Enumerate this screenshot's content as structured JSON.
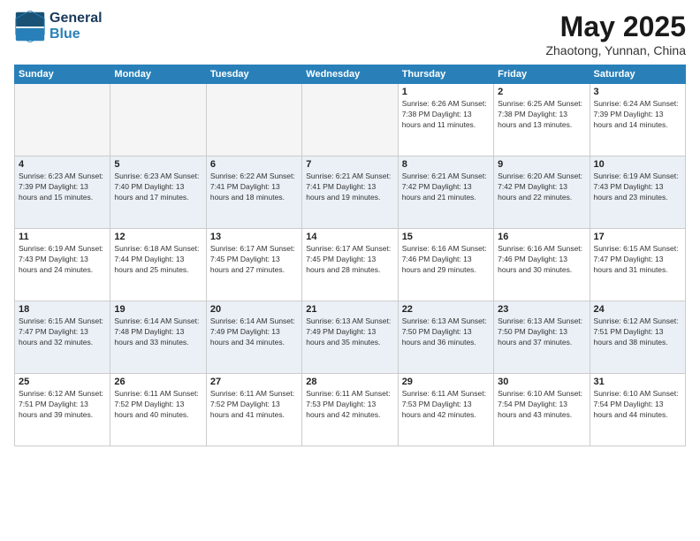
{
  "header": {
    "logo_line1": "General",
    "logo_line2": "Blue",
    "month": "May 2025",
    "location": "Zhaotong, Yunnan, China"
  },
  "days_of_week": [
    "Sunday",
    "Monday",
    "Tuesday",
    "Wednesday",
    "Thursday",
    "Friday",
    "Saturday"
  ],
  "weeks": [
    [
      {
        "day": "",
        "info": ""
      },
      {
        "day": "",
        "info": ""
      },
      {
        "day": "",
        "info": ""
      },
      {
        "day": "",
        "info": ""
      },
      {
        "day": "1",
        "info": "Sunrise: 6:26 AM\nSunset: 7:38 PM\nDaylight: 13 hours\nand 11 minutes."
      },
      {
        "day": "2",
        "info": "Sunrise: 6:25 AM\nSunset: 7:38 PM\nDaylight: 13 hours\nand 13 minutes."
      },
      {
        "day": "3",
        "info": "Sunrise: 6:24 AM\nSunset: 7:39 PM\nDaylight: 13 hours\nand 14 minutes."
      }
    ],
    [
      {
        "day": "4",
        "info": "Sunrise: 6:23 AM\nSunset: 7:39 PM\nDaylight: 13 hours\nand 15 minutes."
      },
      {
        "day": "5",
        "info": "Sunrise: 6:23 AM\nSunset: 7:40 PM\nDaylight: 13 hours\nand 17 minutes."
      },
      {
        "day": "6",
        "info": "Sunrise: 6:22 AM\nSunset: 7:41 PM\nDaylight: 13 hours\nand 18 minutes."
      },
      {
        "day": "7",
        "info": "Sunrise: 6:21 AM\nSunset: 7:41 PM\nDaylight: 13 hours\nand 19 minutes."
      },
      {
        "day": "8",
        "info": "Sunrise: 6:21 AM\nSunset: 7:42 PM\nDaylight: 13 hours\nand 21 minutes."
      },
      {
        "day": "9",
        "info": "Sunrise: 6:20 AM\nSunset: 7:42 PM\nDaylight: 13 hours\nand 22 minutes."
      },
      {
        "day": "10",
        "info": "Sunrise: 6:19 AM\nSunset: 7:43 PM\nDaylight: 13 hours\nand 23 minutes."
      }
    ],
    [
      {
        "day": "11",
        "info": "Sunrise: 6:19 AM\nSunset: 7:43 PM\nDaylight: 13 hours\nand 24 minutes."
      },
      {
        "day": "12",
        "info": "Sunrise: 6:18 AM\nSunset: 7:44 PM\nDaylight: 13 hours\nand 25 minutes."
      },
      {
        "day": "13",
        "info": "Sunrise: 6:17 AM\nSunset: 7:45 PM\nDaylight: 13 hours\nand 27 minutes."
      },
      {
        "day": "14",
        "info": "Sunrise: 6:17 AM\nSunset: 7:45 PM\nDaylight: 13 hours\nand 28 minutes."
      },
      {
        "day": "15",
        "info": "Sunrise: 6:16 AM\nSunset: 7:46 PM\nDaylight: 13 hours\nand 29 minutes."
      },
      {
        "day": "16",
        "info": "Sunrise: 6:16 AM\nSunset: 7:46 PM\nDaylight: 13 hours\nand 30 minutes."
      },
      {
        "day": "17",
        "info": "Sunrise: 6:15 AM\nSunset: 7:47 PM\nDaylight: 13 hours\nand 31 minutes."
      }
    ],
    [
      {
        "day": "18",
        "info": "Sunrise: 6:15 AM\nSunset: 7:47 PM\nDaylight: 13 hours\nand 32 minutes."
      },
      {
        "day": "19",
        "info": "Sunrise: 6:14 AM\nSunset: 7:48 PM\nDaylight: 13 hours\nand 33 minutes."
      },
      {
        "day": "20",
        "info": "Sunrise: 6:14 AM\nSunset: 7:49 PM\nDaylight: 13 hours\nand 34 minutes."
      },
      {
        "day": "21",
        "info": "Sunrise: 6:13 AM\nSunset: 7:49 PM\nDaylight: 13 hours\nand 35 minutes."
      },
      {
        "day": "22",
        "info": "Sunrise: 6:13 AM\nSunset: 7:50 PM\nDaylight: 13 hours\nand 36 minutes."
      },
      {
        "day": "23",
        "info": "Sunrise: 6:13 AM\nSunset: 7:50 PM\nDaylight: 13 hours\nand 37 minutes."
      },
      {
        "day": "24",
        "info": "Sunrise: 6:12 AM\nSunset: 7:51 PM\nDaylight: 13 hours\nand 38 minutes."
      }
    ],
    [
      {
        "day": "25",
        "info": "Sunrise: 6:12 AM\nSunset: 7:51 PM\nDaylight: 13 hours\nand 39 minutes."
      },
      {
        "day": "26",
        "info": "Sunrise: 6:11 AM\nSunset: 7:52 PM\nDaylight: 13 hours\nand 40 minutes."
      },
      {
        "day": "27",
        "info": "Sunrise: 6:11 AM\nSunset: 7:52 PM\nDaylight: 13 hours\nand 41 minutes."
      },
      {
        "day": "28",
        "info": "Sunrise: 6:11 AM\nSunset: 7:53 PM\nDaylight: 13 hours\nand 42 minutes."
      },
      {
        "day": "29",
        "info": "Sunrise: 6:11 AM\nSunset: 7:53 PM\nDaylight: 13 hours\nand 42 minutes."
      },
      {
        "day": "30",
        "info": "Sunrise: 6:10 AM\nSunset: 7:54 PM\nDaylight: 13 hours\nand 43 minutes."
      },
      {
        "day": "31",
        "info": "Sunrise: 6:10 AM\nSunset: 7:54 PM\nDaylight: 13 hours\nand 44 minutes."
      }
    ]
  ]
}
